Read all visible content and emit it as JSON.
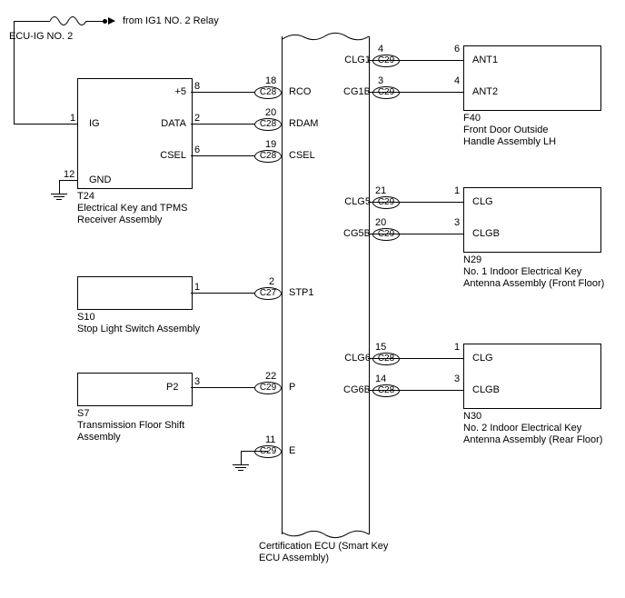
{
  "source": {
    "label": "from IG1 NO. 2 Relay"
  },
  "fuse": {
    "label": "ECU-IG NO. 2"
  },
  "receiver": {
    "id": "T24",
    "name": "Electrical Key and TPMS\nReceiver Assembly",
    "pins": {
      "ig": {
        "name": "IG",
        "num": "1"
      },
      "p5": {
        "name": "+5",
        "num": "8"
      },
      "data": {
        "name": "DATA",
        "num": "2"
      },
      "csel": {
        "name": "CSEL",
        "num": "6"
      },
      "gnd": {
        "name": "GND",
        "num": "12"
      }
    }
  },
  "stop_switch": {
    "id": "S10",
    "name": "Stop Light Switch Assembly",
    "pins": {
      "p1": {
        "num": "1"
      }
    }
  },
  "shift": {
    "id": "S7",
    "name": "Transmission Floor Shift\nAssembly",
    "pins": {
      "p2": {
        "name": "P2",
        "num": "3"
      }
    }
  },
  "cert_ecu": {
    "name": "Certification ECU (Smart Key\nECU Assembly)",
    "pins": {
      "rco": {
        "name": "RCO",
        "num": "18",
        "conn": "C28"
      },
      "rdam": {
        "name": "RDAM",
        "num": "20",
        "conn": "C28"
      },
      "csel": {
        "name": "CSEL",
        "num": "19",
        "conn": "C28"
      },
      "stp1": {
        "name": "STP1",
        "num": "2",
        "conn": "C27"
      },
      "p": {
        "name": "P",
        "num": "22",
        "conn": "C29"
      },
      "e": {
        "name": "E",
        "num": "11",
        "conn": "C29"
      },
      "clg1": {
        "name": "CLG1",
        "num": "4",
        "conn": "C29"
      },
      "cg1b": {
        "name": "CG1B",
        "num": "3",
        "conn": "C29"
      },
      "clg5": {
        "name": "CLG5",
        "num": "21",
        "conn": "C29"
      },
      "cg5b": {
        "name": "CG5B",
        "num": "20",
        "conn": "C29"
      },
      "clg6": {
        "name": "CLG6",
        "num": "15",
        "conn": "C28"
      },
      "cg6b": {
        "name": "CG6B",
        "num": "14",
        "conn": "C28"
      }
    }
  },
  "door_handle": {
    "id": "F40",
    "name": "Front Door Outside\nHandle Assembly LH",
    "pins": {
      "ant1": {
        "name": "ANT1",
        "num": "6"
      },
      "ant2": {
        "name": "ANT2",
        "num": "4"
      }
    }
  },
  "antenna1": {
    "id": "N29",
    "name": "No. 1 Indoor Electrical Key\nAntenna Assembly (Front Floor)",
    "pins": {
      "clg": {
        "name": "CLG",
        "num": "1"
      },
      "clgb": {
        "name": "CLGB",
        "num": "3"
      }
    }
  },
  "antenna2": {
    "id": "N30",
    "name": "No. 2 Indoor Electrical Key\nAntenna Assembly (Rear Floor)",
    "pins": {
      "clg": {
        "name": "CLG",
        "num": "1"
      },
      "clgb": {
        "name": "CLGB",
        "num": "3"
      }
    }
  }
}
